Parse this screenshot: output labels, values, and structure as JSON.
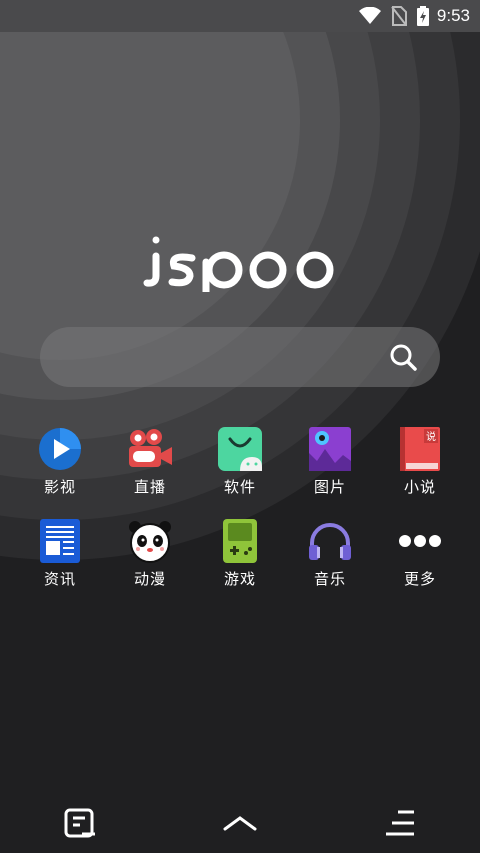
{
  "status_bar": {
    "time": "9:53"
  },
  "brand": {
    "logo_text": "jspoo"
  },
  "search": {
    "placeholder": "",
    "value": ""
  },
  "apps": [
    {
      "label": "影视",
      "icon": "video-play-icon"
    },
    {
      "label": "直播",
      "icon": "live-camera-icon"
    },
    {
      "label": "软件",
      "icon": "app-store-icon"
    },
    {
      "label": "图片",
      "icon": "picture-icon"
    },
    {
      "label": "小说",
      "icon": "novel-book-icon",
      "badge": "说"
    },
    {
      "label": "资讯",
      "icon": "news-icon"
    },
    {
      "label": "动漫",
      "icon": "panda-icon"
    },
    {
      "label": "游戏",
      "icon": "gameboy-icon"
    },
    {
      "label": "音乐",
      "icon": "headphones-icon"
    },
    {
      "label": "更多",
      "icon": "more-dots-icon"
    }
  ],
  "colors": {
    "background": "#1f1f21",
    "status_bar": "#4a4a4c",
    "search_bar": "#6e6e70"
  }
}
